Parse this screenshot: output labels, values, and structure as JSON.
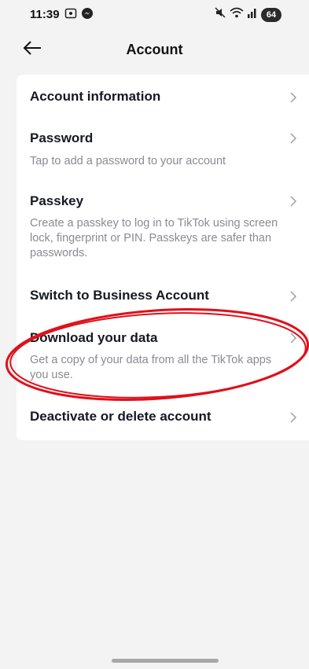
{
  "status_bar": {
    "time": "11:39",
    "battery": "64",
    "icons": [
      "screen-record-icon",
      "messenger-icon",
      "mute-icon",
      "wifi-icon",
      "signal-icon"
    ]
  },
  "header": {
    "title": "Account",
    "back_icon": "back-arrow-icon"
  },
  "menu": {
    "items": [
      {
        "title": "Account information",
        "description": ""
      },
      {
        "title": "Password",
        "description": "Tap to add a password to your account"
      },
      {
        "title": "Passkey",
        "description": "Create a passkey to log in to TikTok using screen lock, fingerprint or PIN. Passkeys are safer than passwords."
      },
      {
        "title": "Switch to Business Account",
        "description": ""
      },
      {
        "title": "Download your data",
        "description": "Get a copy of your data from all the TikTok apps you use."
      },
      {
        "title": "Deactivate or delete account",
        "description": ""
      }
    ]
  },
  "annotation": {
    "shape": "ellipse",
    "color": "#e0101a",
    "target": "Download your data"
  },
  "colors": {
    "background": "#f3f3f3",
    "card": "#ffffff",
    "title_text": "#161823",
    "desc_text": "#8a8b91",
    "chevron": "#a0a1a6"
  }
}
